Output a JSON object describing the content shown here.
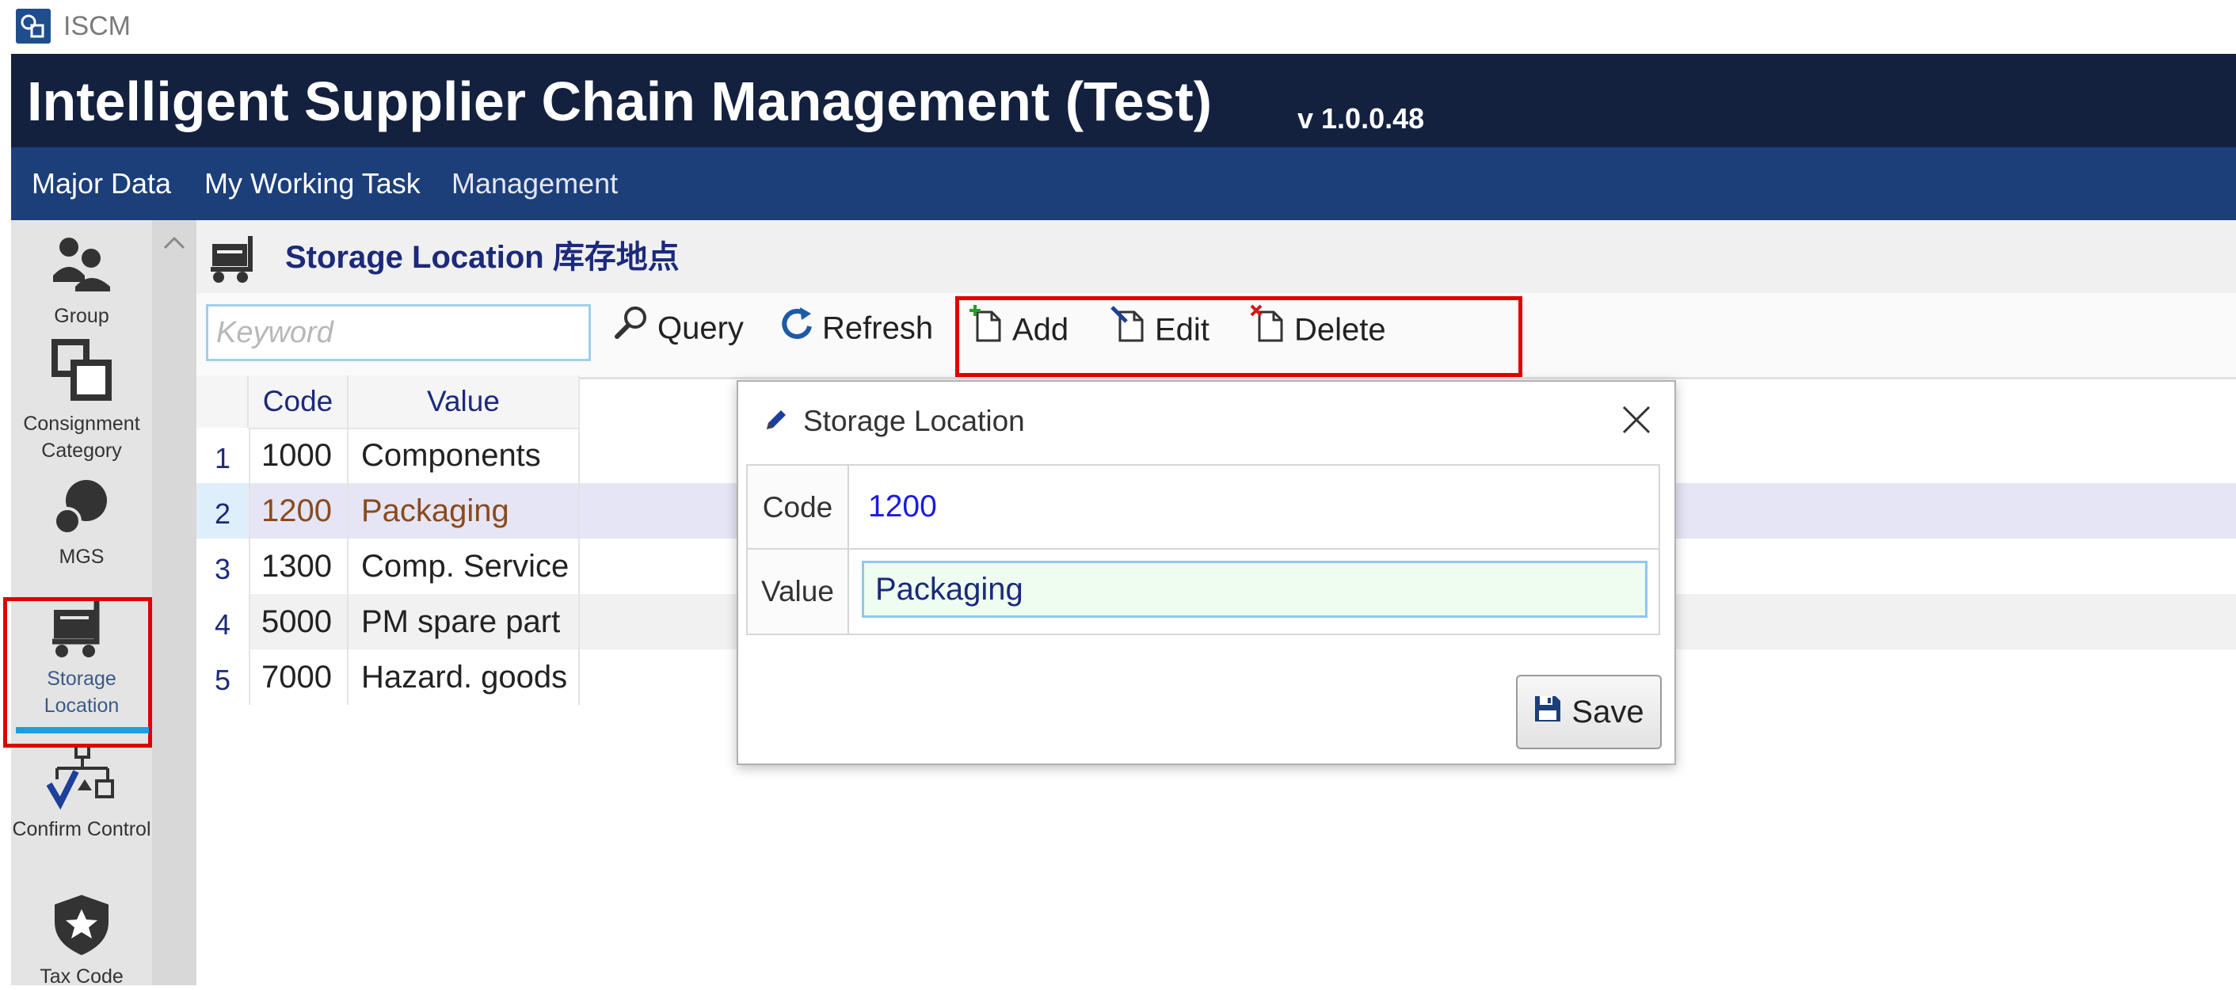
{
  "window": {
    "app_name": "ISCM"
  },
  "banner": {
    "title": "Intelligent Supplier Chain Management (Test)",
    "version": "v 1.0.0.48"
  },
  "menu": {
    "items": [
      "Major Data",
      "My Working Task",
      "Management"
    ]
  },
  "sidebar": {
    "items": [
      {
        "label": "Group",
        "icon": "group-icon"
      },
      {
        "label": "Consignment Category",
        "icon": "consignment-icon"
      },
      {
        "label": "MGS",
        "icon": "mgs-icon"
      },
      {
        "label": "Storage Location",
        "icon": "storage-cart-icon",
        "selected": true
      },
      {
        "label": "Confirm Control",
        "icon": "confirm-control-icon"
      },
      {
        "label": "Tax Code",
        "icon": "tax-badge-icon"
      }
    ],
    "scroll_up": "^"
  },
  "page": {
    "title": "Storage Location 库存地点"
  },
  "toolbar": {
    "keyword_placeholder": "Keyword",
    "query": "Query",
    "refresh": "Refresh",
    "add": "Add",
    "edit": "Edit",
    "delete": "Delete"
  },
  "grid": {
    "columns": [
      "Code",
      "Value"
    ],
    "rows": [
      {
        "num": "1",
        "code": "1000",
        "value": "Components"
      },
      {
        "num": "2",
        "code": "1200",
        "value": "Packaging",
        "selected": true
      },
      {
        "num": "3",
        "code": "1300",
        "value": "Comp. Service"
      },
      {
        "num": "4",
        "code": "5000",
        "value": "PM spare part"
      },
      {
        "num": "5",
        "code": "7000",
        "value": "Hazard. goods"
      }
    ]
  },
  "dialog": {
    "title": "Storage Location",
    "code_label": "Code",
    "code_value": "1200",
    "value_label": "Value",
    "value_value": "Packaging",
    "save": "Save"
  },
  "colors": {
    "banner": "#13213e",
    "menubar": "#1c3f7a",
    "title_text": "#1c2a7a",
    "highlight": "#e00000",
    "selected_underline": "#1a9fe0"
  }
}
